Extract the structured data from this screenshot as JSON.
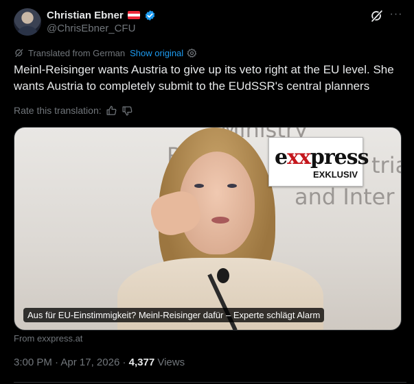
{
  "author": {
    "name": "Christian Ebner",
    "handle": "@ChrisEbner_CFU",
    "flag_colors": [
      "#ed2939",
      "#ffffff",
      "#ed2939"
    ],
    "verified_color": "#1d9bf0"
  },
  "header_icons": {
    "grok": "grok-icon",
    "more": "more-icon",
    "more_glyph": "···"
  },
  "translation": {
    "label": "Translated from German",
    "show_original": "Show original",
    "settings_icon": "gear-icon"
  },
  "tweet": {
    "text": "Meinl-Reisinger wants Austria to give up its veto right at the EU level. She wants Austria to completely submit to the EUdSSR's central planners"
  },
  "rating": {
    "label": "Rate this translation:",
    "up_icon": "thumbs-up-icon",
    "down_icon": "thumbs-down-icon"
  },
  "media": {
    "logo_brand_prefix": "e",
    "logo_brand_xx": "xx",
    "logo_brand_suffix": "press",
    "logo_tag": "EXKLUSIV",
    "caption": "Aus für EU-Einstimmigkeit? Meinl-Reisinger dafür – Experte schlägt Alarm",
    "bg_text_1": "Ministry",
    "bg_text_2": "R",
    "bg_text_3": "tria",
    "bg_text_4": "and Inter"
  },
  "source": {
    "label": "From exxpress.at"
  },
  "meta": {
    "time": "3:00 PM",
    "sep1": " · ",
    "date": "Apr 17, 2026",
    "sep2": " · ",
    "views_count": "4,377",
    "views_label": " Views"
  }
}
